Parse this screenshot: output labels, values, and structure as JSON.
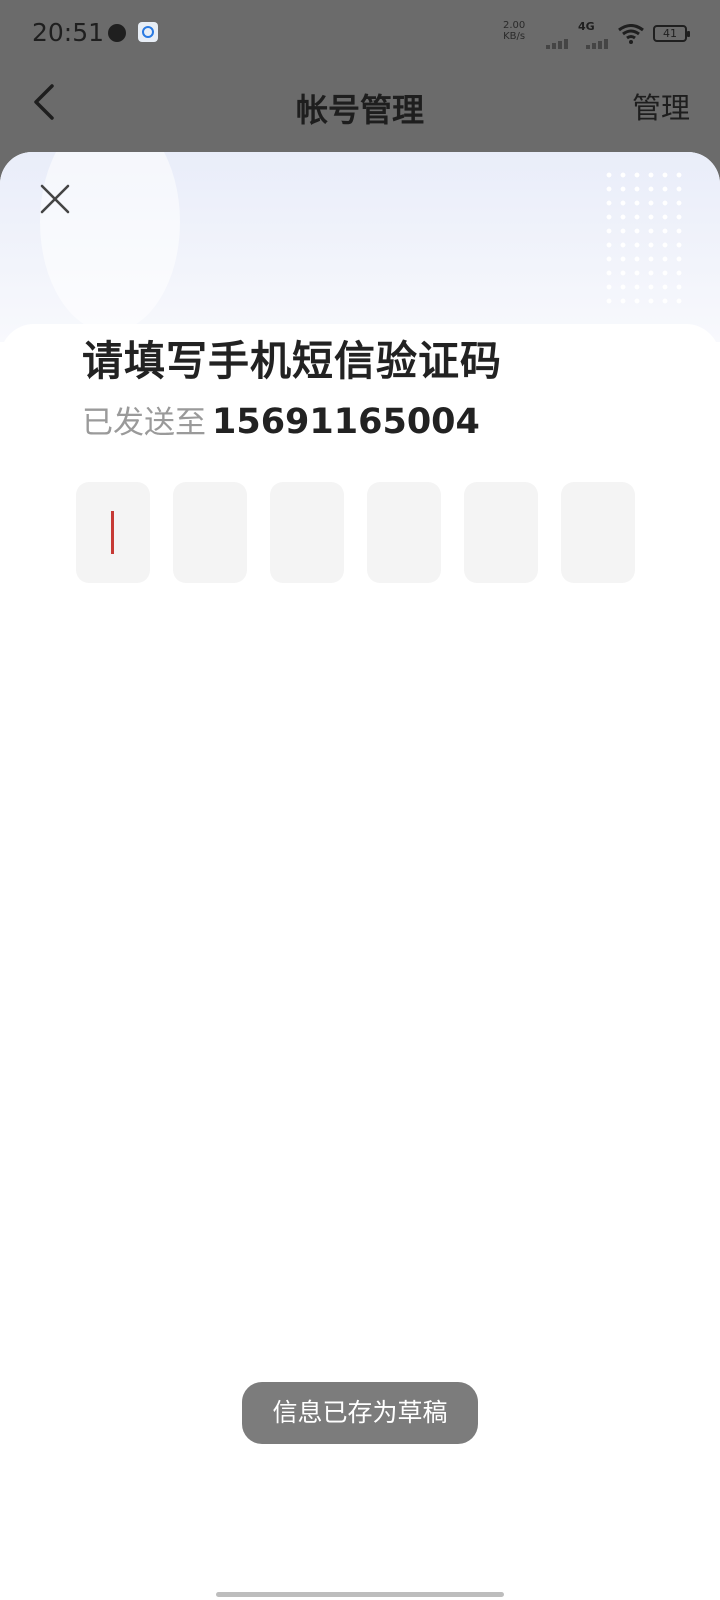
{
  "status_bar": {
    "time": "20:51",
    "net_speed_value": "2.00",
    "net_speed_unit": "KB/s",
    "network_type": "4G",
    "battery_level": "41",
    "icons": [
      "location-icon",
      "app-notification-icon",
      "signal-icon",
      "signal-4g-icon",
      "wifi-icon",
      "battery-icon"
    ]
  },
  "header": {
    "title": "帐号管理",
    "manage_label": "管理"
  },
  "verification": {
    "title": "请填写手机短信验证码",
    "sent_label": "已发送至",
    "phone": "15691165004",
    "code_length": 6,
    "cursor_color": "#c63a35"
  },
  "toast": {
    "message": "信息已存为草稿"
  },
  "colors": {
    "overlay": "#6b6b6b",
    "code_box": "#f4f4f4",
    "toast_bg": "#7c7c7c"
  }
}
